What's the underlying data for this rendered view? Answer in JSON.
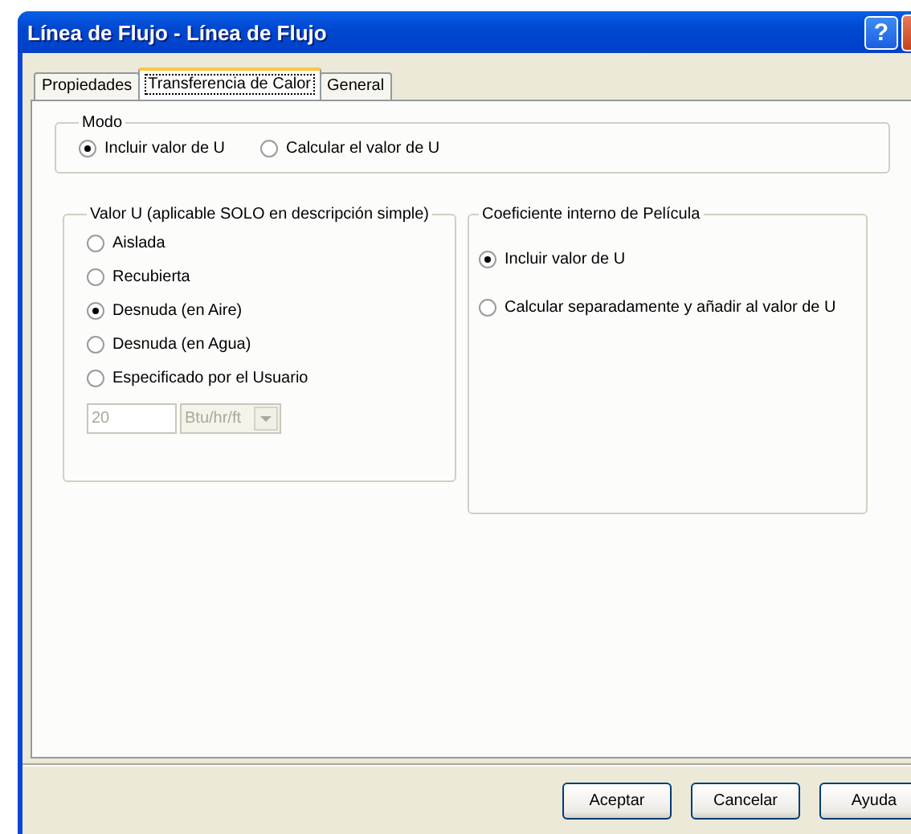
{
  "window": {
    "title": "Línea de Flujo - Línea de Flujo",
    "help_button": "?"
  },
  "tabs": [
    {
      "label": "Propiedades",
      "selected": false
    },
    {
      "label": "Transferencia de Calor",
      "selected": true
    },
    {
      "label": "General",
      "selected": false
    }
  ],
  "modo": {
    "title": "Modo",
    "options": [
      {
        "label": "Incluir valor de U",
        "selected": true
      },
      {
        "label": "Calcular el valor de U",
        "selected": false
      }
    ]
  },
  "valor_u": {
    "title": "Valor U (aplicable SOLO en descripción simple)",
    "options": [
      {
        "label": "Aislada",
        "selected": false
      },
      {
        "label": "Recubierta",
        "selected": false
      },
      {
        "label": "Desnuda (en Aire)",
        "selected": true
      },
      {
        "label": "Desnuda (en Agua)",
        "selected": false
      },
      {
        "label": "Especificado por el Usuario",
        "selected": false
      }
    ],
    "value": "20",
    "unit": "Btu/hr/ft",
    "disabled": true
  },
  "coeficiente": {
    "title": "Coeficiente interno de Película",
    "options": [
      {
        "label": "Incluir valor de U",
        "selected": true
      },
      {
        "label": "Calcular separadamente y añadir al valor de U",
        "selected": false
      }
    ]
  },
  "buttons": [
    "Aceptar",
    "Cancelar",
    "Ayuda"
  ]
}
